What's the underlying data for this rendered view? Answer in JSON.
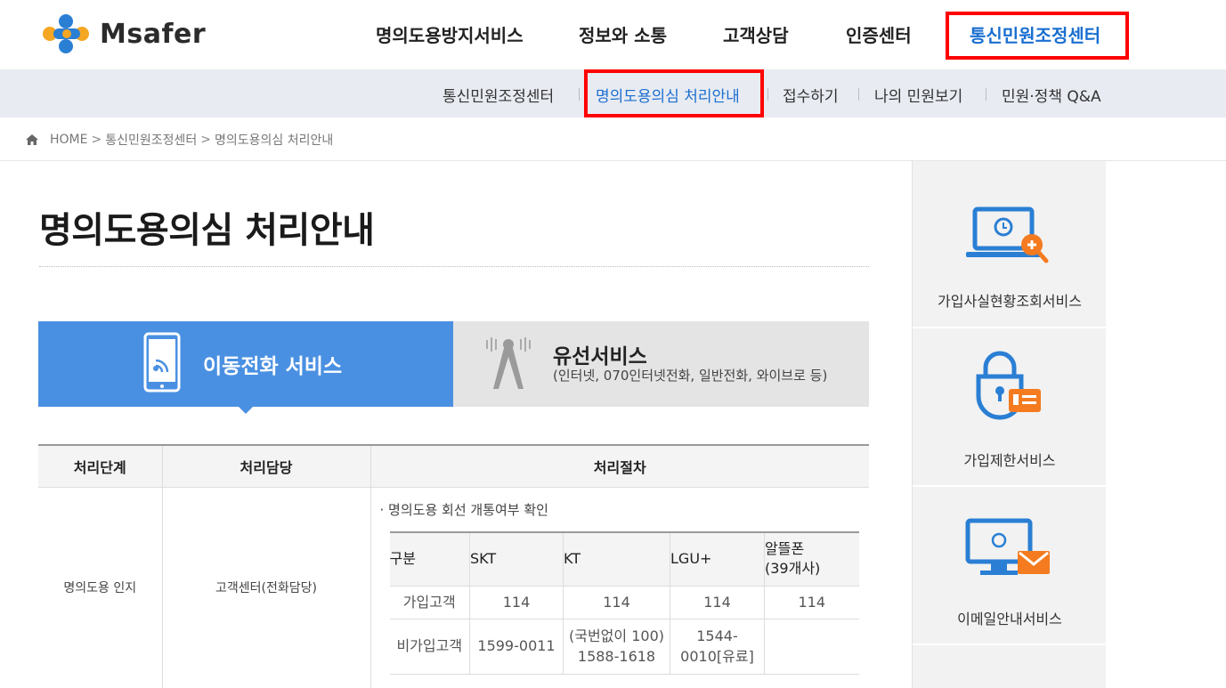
{
  "header": {
    "logo_text": "Msafer",
    "nav": [
      {
        "label": "명의도용방지서비스"
      },
      {
        "label": "정보와 소통"
      },
      {
        "label": "고객상담"
      },
      {
        "label": "인증센터"
      },
      {
        "label": "통신민원조정센터"
      }
    ]
  },
  "subnav": {
    "items": [
      {
        "label": "통신민원조정센터"
      },
      {
        "label": "명의도용의심 처리안내"
      },
      {
        "label": "접수하기"
      },
      {
        "label": "나의 민원보기"
      },
      {
        "label": "민원·정책 Q&A"
      }
    ]
  },
  "breadcrumb": {
    "items": [
      "HOME",
      "통신민원조정센터",
      "명의도용의심 처리안내"
    ]
  },
  "page": {
    "title": "명의도용의심 처리안내"
  },
  "tabs": {
    "mobile": {
      "label": "이동전화 서비스"
    },
    "wired": {
      "label": "유선서비스",
      "sub": "(인터넷, 070인터넷전화, 일반전화, 와이브로 등)"
    }
  },
  "table": {
    "headers": [
      "처리단계",
      "처리담당",
      "처리절차"
    ],
    "row": {
      "stage": "명의도용 인지",
      "owner": "고객센터(전화담당)",
      "bullet": "명의도용 회선 개통여부 확인"
    },
    "inner": {
      "headers": [
        "구분",
        "SKT",
        "KT",
        "LGU+",
        "알뜰폰\n(39개사)"
      ],
      "header_line1": "알뜰폰",
      "header_line2": "(39개사)",
      "rows": [
        [
          "가입고객",
          "114",
          "114",
          "114",
          "114"
        ],
        [
          "비가입고객",
          "1599-0011",
          "(국번없이 100)\n1588-1618",
          "1544-\n0010[유료]",
          ""
        ]
      ],
      "r2_kt_line1": "(국번없이 100)",
      "r2_kt_line2": "1588-1618",
      "r2_lgu_line1": "1544-",
      "r2_lgu_line2": "0010[유료]"
    }
  },
  "side": {
    "items": [
      {
        "label": "가입사실현황조회서비스",
        "icon": "laptop-search-icon"
      },
      {
        "label": "가입제한서비스",
        "icon": "lock-id-icon"
      },
      {
        "label": "이메일안내서비스",
        "icon": "monitor-mail-icon"
      }
    ]
  },
  "colors": {
    "accent": "#1a6fd0",
    "tab_blue": "#4a90e2",
    "highlight_red": "#ff0000",
    "icon_orange": "#f47b20"
  }
}
